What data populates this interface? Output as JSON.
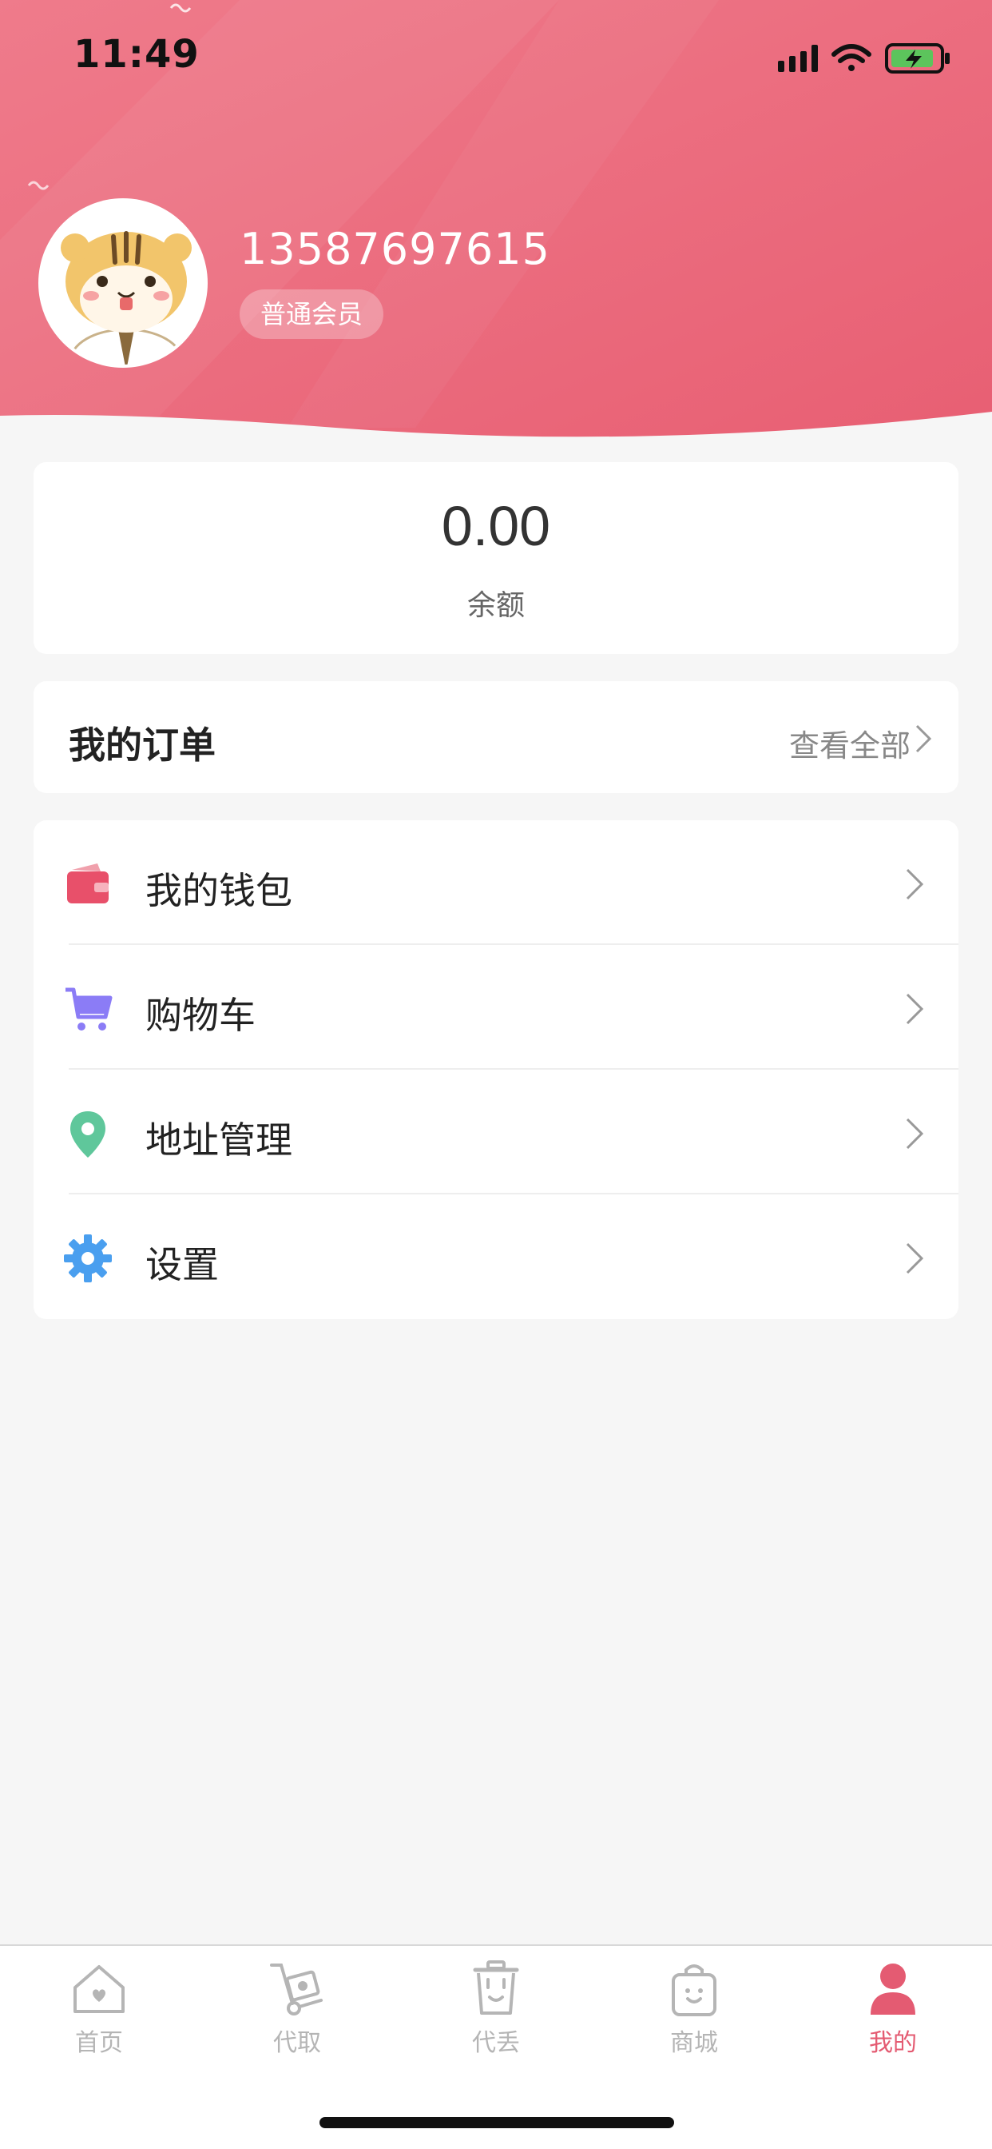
{
  "status_bar": {
    "time": "11:49"
  },
  "profile": {
    "phone": "13587697615",
    "member_level": "普通会员"
  },
  "balance": {
    "value": "0.00",
    "label": "余额"
  },
  "orders": {
    "title": "我的订单",
    "view_all": "查看全部"
  },
  "menu": {
    "items": [
      {
        "label": "我的钱包",
        "icon": "wallet-icon",
        "color": "#e8506a"
      },
      {
        "label": "购物车",
        "icon": "cart-icon",
        "color": "#8b7cf6"
      },
      {
        "label": "地址管理",
        "icon": "location-pin-icon",
        "color": "#5fc79b"
      },
      {
        "label": "设置",
        "icon": "gear-icon",
        "color": "#4a9fef"
      }
    ]
  },
  "tabbar": {
    "tabs": [
      {
        "label": "首页",
        "icon": "home-icon",
        "active": false
      },
      {
        "label": "代取",
        "icon": "hand-truck-icon",
        "active": false
      },
      {
        "label": "代丢",
        "icon": "trash-can-icon",
        "active": false
      },
      {
        "label": "商城",
        "icon": "shopping-bag-icon",
        "active": false
      },
      {
        "label": "我的",
        "icon": "person-icon",
        "active": true
      }
    ]
  },
  "colors": {
    "brand": "#ea6076",
    "active_tab": "#e45b72",
    "inactive_tab": "#b5b5b5",
    "background": "#f6f6f6"
  }
}
